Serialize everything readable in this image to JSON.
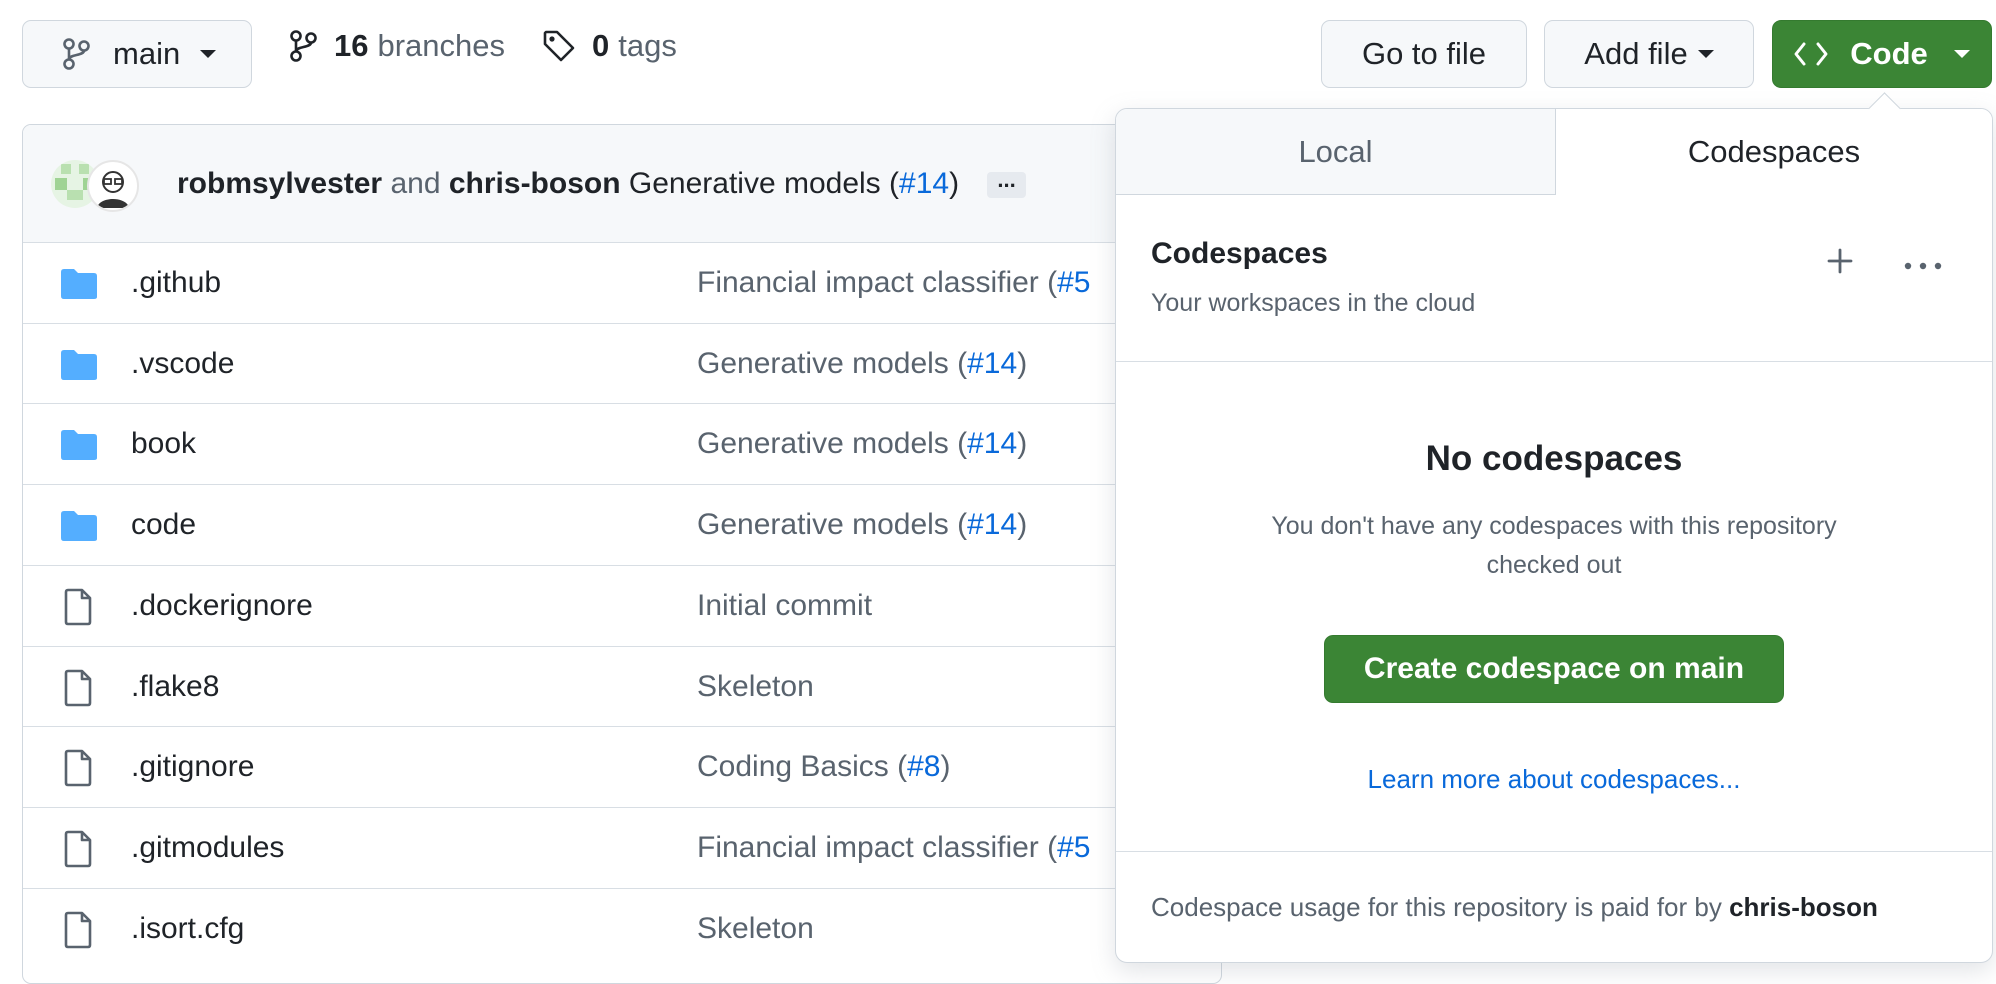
{
  "toolbar": {
    "branch_label": "main",
    "branches_count": "16",
    "branches_label": "branches",
    "tags_count": "0",
    "tags_label": "tags",
    "goto_file": "Go to file",
    "add_file": "Add file",
    "code": "Code"
  },
  "commit": {
    "author1": "robmsylvester",
    "conj": "and",
    "author2": "chris-boson",
    "message": "Generative models (",
    "pr": "#14",
    "close": ")",
    "ellipsis": "..."
  },
  "files": [
    {
      "name": ".github",
      "type": "folder",
      "msg": "Financial impact classifier (",
      "pr": "#5",
      "close": ""
    },
    {
      "name": ".vscode",
      "type": "folder",
      "msg": "Generative models (",
      "pr": "#14",
      "close": ")"
    },
    {
      "name": "book",
      "type": "folder",
      "msg": "Generative models (",
      "pr": "#14",
      "close": ")"
    },
    {
      "name": "code",
      "type": "folder",
      "msg": "Generative models (",
      "pr": "#14",
      "close": ")"
    },
    {
      "name": ".dockerignore",
      "type": "file",
      "msg": "Initial commit",
      "pr": "",
      "close": ""
    },
    {
      "name": ".flake8",
      "type": "file",
      "msg": "Skeleton",
      "pr": "",
      "close": ""
    },
    {
      "name": ".gitignore",
      "type": "file",
      "msg": "Coding Basics (",
      "pr": "#8",
      "close": ")"
    },
    {
      "name": ".gitmodules",
      "type": "file",
      "msg": "Financial impact classifier (",
      "pr": "#5",
      "close": ""
    },
    {
      "name": ".isort.cfg",
      "type": "file",
      "msg": "Skeleton",
      "pr": "",
      "close": ""
    }
  ],
  "panel": {
    "tab_local": "Local",
    "tab_codespaces": "Codespaces",
    "title": "Codespaces",
    "subtitle": "Your workspaces in the cloud",
    "empty_title": "No codespaces",
    "empty_desc": "You don't have any codespaces with this repository checked out",
    "create_button": "Create codespace on main",
    "learn_more": "Learn more about codespaces...",
    "footer_text": "Codespace usage for this repository is paid for by",
    "footer_user": "chris-boson"
  },
  "colors": {
    "accent_green": "#3b8535",
    "link_blue": "#0969da",
    "folder_blue": "#54aeff"
  }
}
